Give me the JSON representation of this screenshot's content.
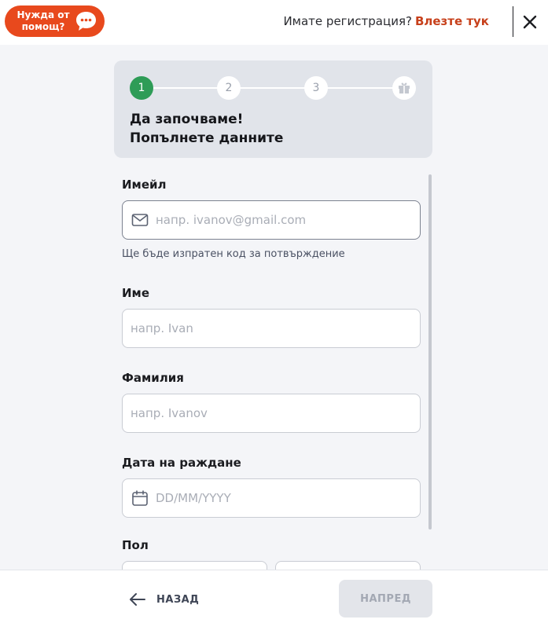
{
  "header": {
    "help_label": "Нужда от помощ?",
    "has_account_text": "Имате регистрация?",
    "login_link": "Влезте тук"
  },
  "stepper": {
    "steps": [
      "1",
      "2",
      "3"
    ],
    "active_step": 1,
    "title_line1": "Да започваме!",
    "title_line2": "Попълнете данните"
  },
  "form": {
    "email": {
      "label": "Имейл",
      "placeholder": "напр. ivanov@gmail.com",
      "hint": "Ще бъде изпратен код за потвърждение"
    },
    "first_name": {
      "label": "Име",
      "placeholder": "напр. Ivan"
    },
    "last_name": {
      "label": "Фамилия",
      "placeholder": "напр. Ivanov"
    },
    "birth_date": {
      "label": "Дата на раждане",
      "placeholder": "DD/MM/YYYY"
    },
    "gender": {
      "label": "Пол"
    }
  },
  "footer": {
    "back_label": "НАЗАД",
    "next_label": "НАПРЕД"
  },
  "colors": {
    "brand_orange": "#e8491d",
    "link_orange": "#c7401b",
    "step_active_green": "#2e9c57"
  }
}
